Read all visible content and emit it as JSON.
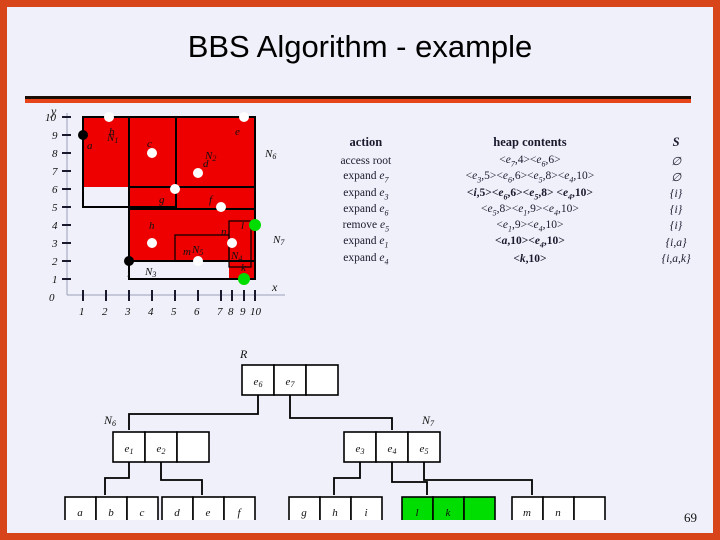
{
  "slide": {
    "title": "BBS Algorithm - example",
    "page_number": "69",
    "accent_border": "#d9451a",
    "background": "#f0f0fa",
    "rule_dark": "#1a0d06",
    "rule_orange": "#e8441a"
  },
  "figure": {
    "name": "mbr-scatter-plot",
    "x_axis_label": "x",
    "y_axis_label": "y",
    "origin_label": "0",
    "x_ticks": [
      "1",
      "2",
      "3",
      "4",
      "5",
      "6",
      "7",
      "8",
      "9",
      "10"
    ],
    "y_ticks": [
      "1",
      "2",
      "3",
      "4",
      "5",
      "6",
      "7",
      "8",
      "9",
      "10"
    ],
    "mbr_fill": "#ee0000",
    "points": [
      {
        "label": "a",
        "x": 1,
        "y": 9,
        "color": "black"
      },
      {
        "label": "b",
        "x": 2.4,
        "y": 10,
        "color": "white"
      },
      {
        "label": "c",
        "x": 4,
        "y": 8,
        "color": "white"
      },
      {
        "label": "d",
        "x": 6,
        "y": 7.2,
        "color": "white"
      },
      {
        "label": "e",
        "x": 9,
        "y": 10,
        "color": "white"
      },
      {
        "label": "f",
        "x": 7,
        "y": 5,
        "color": "white"
      },
      {
        "label": "g",
        "x": 5,
        "y": 6,
        "color": "white"
      },
      {
        "label": "h",
        "x": 4,
        "y": 3,
        "color": "white"
      },
      {
        "label": "i",
        "x": 3,
        "y": 2,
        "color": "black"
      },
      {
        "label": "k",
        "x": 9,
        "y": 1,
        "color": "green"
      },
      {
        "label": "l",
        "x": 10,
        "y": 4,
        "color": "green"
      },
      {
        "label": "m",
        "x": 6,
        "y": 2,
        "color": "white"
      },
      {
        "label": "n",
        "x": 8,
        "y": 3,
        "color": "white"
      }
    ],
    "regions": [
      {
        "label": "N1"
      },
      {
        "label": "N2"
      },
      {
        "label": "N3"
      },
      {
        "label": "N4"
      },
      {
        "label": "N5"
      },
      {
        "label": "N6"
      },
      {
        "label": "N7"
      }
    ]
  },
  "trace": {
    "headers": {
      "action": "action",
      "heap": "heap contents",
      "s": "S"
    },
    "rows": [
      {
        "action": "access root",
        "action_entry": "",
        "heap": "<e7,4><e6,6>",
        "s": "∅",
        "bold": false
      },
      {
        "action": "expand ",
        "action_entry": "e7",
        "heap": "<e3,5><e6,6><e5,8><e4,10>",
        "s": "∅",
        "bold": false
      },
      {
        "action": "expand ",
        "action_entry": "e3",
        "heap": "<i,5><e6,6><e5,8> <e4,10>",
        "s": "{i}",
        "bold": true
      },
      {
        "action": "expand ",
        "action_entry": "e6",
        "heap": "<e5,8><e1,9><e4,10>",
        "s": "{i}",
        "bold": false
      },
      {
        "action": "remove ",
        "action_entry": "e5",
        "heap": "<e1,9><e4,10>",
        "s": "{i}",
        "bold": false
      },
      {
        "action": "expand ",
        "action_entry": "e1",
        "heap": "<a,10><e4,10>",
        "s": "{i,a}",
        "bold": true
      },
      {
        "action": "expand ",
        "action_entry": "e4",
        "heap": "<k,10>",
        "s": "{i,a,k}",
        "bold": true
      }
    ]
  },
  "tree": {
    "name": "r-tree-structure",
    "highlight_color": "#00dd00",
    "nodes": [
      {
        "id": "R",
        "label": "R",
        "entries": [
          "e6",
          "e7",
          ""
        ],
        "highlight": [
          false,
          false,
          false
        ]
      },
      {
        "id": "N6",
        "label": "N6",
        "entries": [
          "e1",
          "e2",
          ""
        ],
        "highlight": [
          false,
          false,
          false
        ]
      },
      {
        "id": "N7",
        "label": "N7",
        "entries": [
          "e3",
          "e4",
          "e5"
        ],
        "highlight": [
          false,
          false,
          false
        ]
      },
      {
        "id": "N1",
        "label": "N1",
        "entries": [
          "a",
          "b",
          "c"
        ],
        "highlight": [
          false,
          false,
          false
        ]
      },
      {
        "id": "N2",
        "label": "N2",
        "entries": [
          "d",
          "e",
          "f"
        ],
        "highlight": [
          false,
          false,
          false
        ]
      },
      {
        "id": "N3",
        "label": "N3",
        "entries": [
          "g",
          "h",
          "i"
        ],
        "highlight": [
          false,
          false,
          false
        ]
      },
      {
        "id": "N4",
        "label": "N4",
        "entries": [
          "l",
          "k",
          ""
        ],
        "highlight": [
          true,
          true,
          true
        ]
      },
      {
        "id": "N5",
        "label": "N5",
        "entries": [
          "m",
          "n",
          ""
        ],
        "highlight": [
          false,
          false,
          false
        ]
      }
    ]
  }
}
